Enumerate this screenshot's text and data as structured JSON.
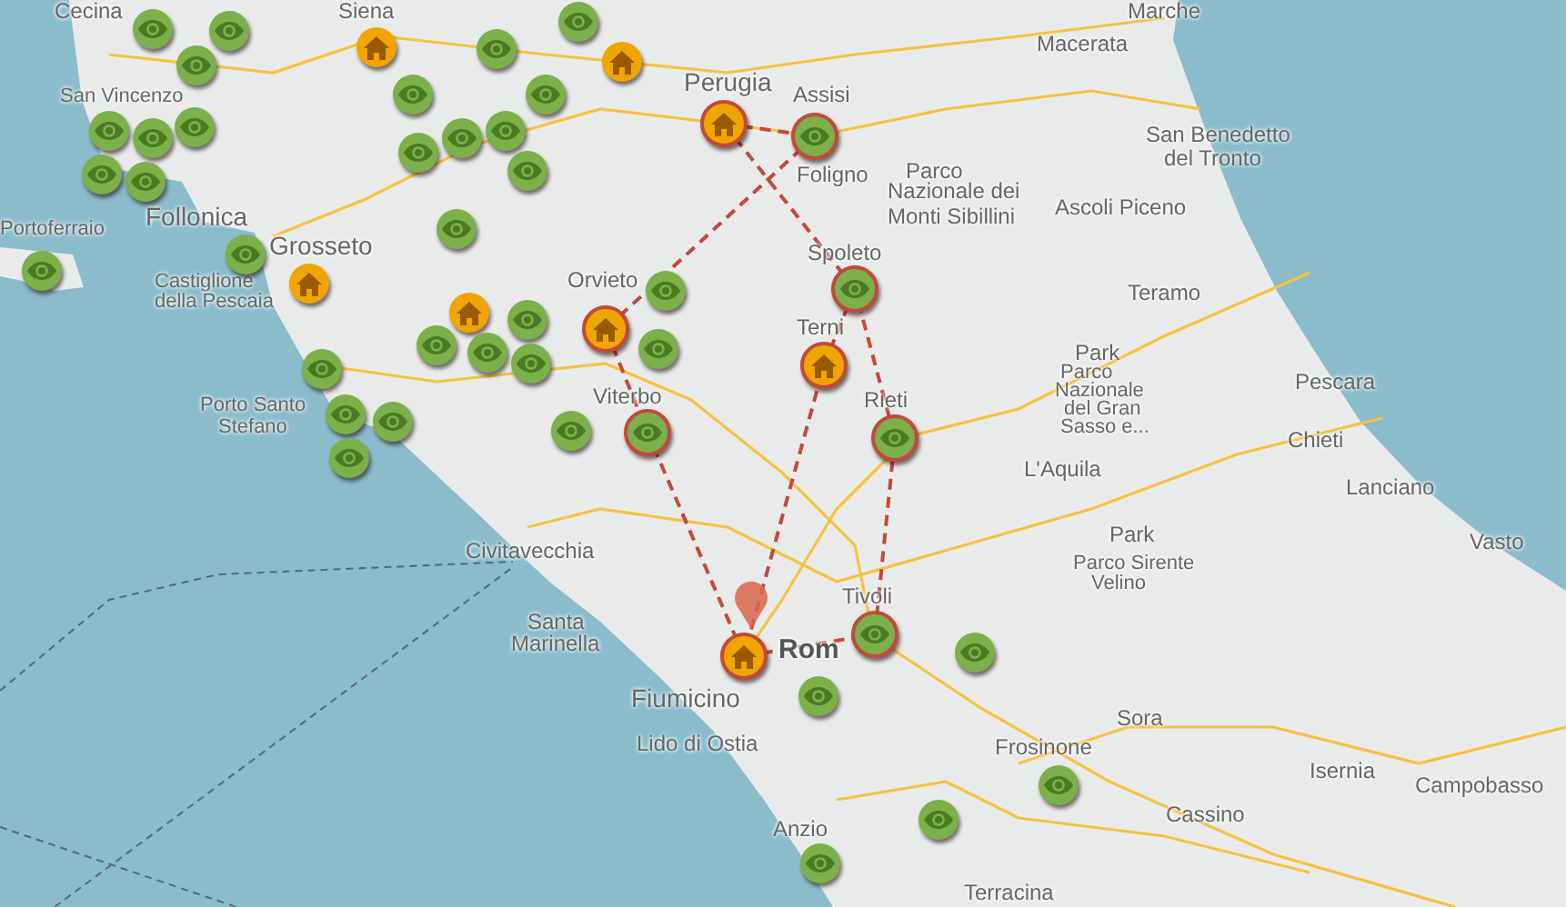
{
  "map": {
    "labels": [
      {
        "text": "Cecina",
        "kind": "city"
      },
      {
        "text": "Siena",
        "kind": "city"
      },
      {
        "text": "Marche",
        "kind": "city"
      },
      {
        "text": "Macerata",
        "kind": "city"
      },
      {
        "text": "San Vincenzo",
        "kind": "small"
      },
      {
        "text": "Perugia",
        "kind": "major"
      },
      {
        "text": "Assisi",
        "kind": "city"
      },
      {
        "text": "San Benedetto",
        "kind": "city"
      },
      {
        "text": "Foligno",
        "kind": "city"
      },
      {
        "text": "Parco",
        "kind": "city"
      },
      {
        "text": "del Tronto",
        "kind": "city"
      },
      {
        "text": "Nazionale dei",
        "kind": "city"
      },
      {
        "text": "Portoferraio",
        "kind": "small"
      },
      {
        "text": "Follonica",
        "kind": "major"
      },
      {
        "text": "Monti Sibillini",
        "kind": "city"
      },
      {
        "text": "Ascoli Piceno",
        "kind": "city"
      },
      {
        "text": "Grosseto",
        "kind": "major"
      },
      {
        "text": "Spoleto",
        "kind": "city"
      },
      {
        "text": "Castiglione",
        "kind": "small"
      },
      {
        "text": "della Pescaia",
        "kind": "small"
      },
      {
        "text": "Orvieto",
        "kind": "city"
      },
      {
        "text": "Teramo",
        "kind": "city"
      },
      {
        "text": "Terni",
        "kind": "city"
      },
      {
        "text": "Park",
        "kind": "city"
      },
      {
        "text": "Parco",
        "kind": "small"
      },
      {
        "text": "Porto Santo",
        "kind": "small"
      },
      {
        "text": "Viterbo",
        "kind": "city"
      },
      {
        "text": "Rieti",
        "kind": "city"
      },
      {
        "text": "Nazionale",
        "kind": "small"
      },
      {
        "text": "Pescara",
        "kind": "city"
      },
      {
        "text": "del Gran",
        "kind": "small"
      },
      {
        "text": "Stefano",
        "kind": "small"
      },
      {
        "text": "Sasso e...",
        "kind": "small"
      },
      {
        "text": "Chieti",
        "kind": "city"
      },
      {
        "text": "L'Aquila",
        "kind": "city"
      },
      {
        "text": "Lanciano",
        "kind": "city"
      },
      {
        "text": "Civitavecchia",
        "kind": "city"
      },
      {
        "text": "Park",
        "kind": "city"
      },
      {
        "text": "Parco Sirente",
        "kind": "small"
      },
      {
        "text": "Vasto",
        "kind": "city"
      },
      {
        "text": "Tivoli",
        "kind": "city"
      },
      {
        "text": "Velino",
        "kind": "small"
      },
      {
        "text": "Santa",
        "kind": "city"
      },
      {
        "text": "Marinella",
        "kind": "city"
      },
      {
        "text": "Rom",
        "kind": "capital"
      },
      {
        "text": "Fiumicino",
        "kind": "major"
      },
      {
        "text": "Sora",
        "kind": "city"
      },
      {
        "text": "Lido di Ostia",
        "kind": "city"
      },
      {
        "text": "Frosinone",
        "kind": "city"
      },
      {
        "text": "Isernia",
        "kind": "city"
      },
      {
        "text": "Campobasso",
        "kind": "city"
      },
      {
        "text": "Cassino",
        "kind": "city"
      },
      {
        "text": "Anzio",
        "kind": "city"
      },
      {
        "text": "Terracina",
        "kind": "city"
      }
    ],
    "markers": [
      {
        "kind": "sight",
        "on_route": false
      },
      {
        "kind": "sight",
        "on_route": false
      },
      {
        "kind": "sight",
        "on_route": false
      },
      {
        "kind": "sight",
        "on_route": false
      },
      {
        "kind": "home",
        "on_route": false
      },
      {
        "kind": "home",
        "on_route": false
      },
      {
        "kind": "sight",
        "on_route": false
      },
      {
        "kind": "sight",
        "on_route": false
      },
      {
        "kind": "sight",
        "on_route": false
      },
      {
        "kind": "home",
        "on_route": true
      },
      {
        "kind": "sight",
        "on_route": false
      },
      {
        "kind": "sight",
        "on_route": false
      },
      {
        "kind": "sight",
        "on_route": false
      },
      {
        "kind": "sight",
        "on_route": true
      },
      {
        "kind": "sight",
        "on_route": false
      },
      {
        "kind": "sight",
        "on_route": false
      },
      {
        "kind": "sight",
        "on_route": false
      },
      {
        "kind": "sight",
        "on_route": false
      },
      {
        "kind": "sight",
        "on_route": false
      },
      {
        "kind": "sight",
        "on_route": false
      },
      {
        "kind": "sight",
        "on_route": false
      },
      {
        "kind": "sight",
        "on_route": false
      },
      {
        "kind": "sight",
        "on_route": false
      },
      {
        "kind": "home",
        "on_route": false
      },
      {
        "kind": "sight",
        "on_route": true
      },
      {
        "kind": "sight",
        "on_route": false
      },
      {
        "kind": "home",
        "on_route": false
      },
      {
        "kind": "sight",
        "on_route": false
      },
      {
        "kind": "home",
        "on_route": true
      },
      {
        "kind": "sight",
        "on_route": false
      },
      {
        "kind": "sight",
        "on_route": false
      },
      {
        "kind": "sight",
        "on_route": false
      },
      {
        "kind": "sight",
        "on_route": false
      },
      {
        "kind": "home",
        "on_route": true
      },
      {
        "kind": "sight",
        "on_route": false
      },
      {
        "kind": "sight",
        "on_route": false
      },
      {
        "kind": "sight",
        "on_route": false
      },
      {
        "kind": "sight",
        "on_route": false
      },
      {
        "kind": "sight",
        "on_route": true
      },
      {
        "kind": "sight",
        "on_route": true
      },
      {
        "kind": "sight",
        "on_route": false
      },
      {
        "kind": "sight",
        "on_route": true
      },
      {
        "kind": "sight",
        "on_route": false
      },
      {
        "kind": "home",
        "on_route": true
      },
      {
        "kind": "sight",
        "on_route": false
      },
      {
        "kind": "sight",
        "on_route": false
      },
      {
        "kind": "sight",
        "on_route": false
      },
      {
        "kind": "sight",
        "on_route": false
      }
    ]
  }
}
